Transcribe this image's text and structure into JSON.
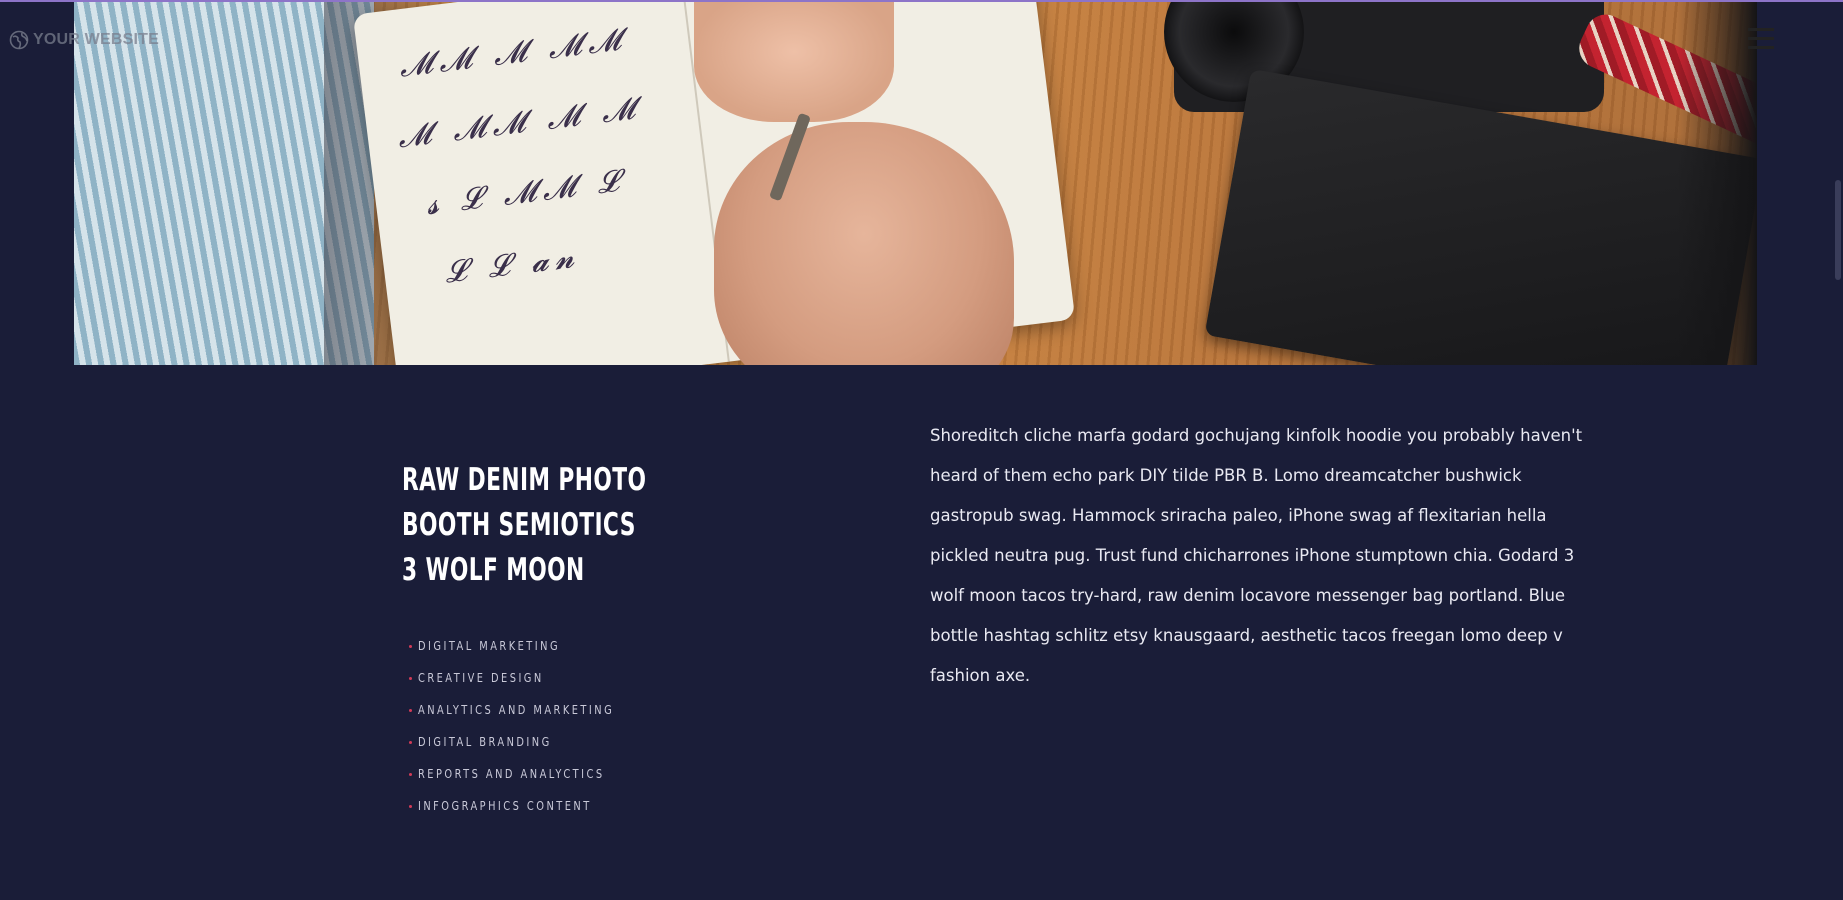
{
  "header": {
    "logo_text": "YOUR WEBSITE",
    "logo_icon": "globe-icon",
    "menu_icon": "hamburger-menu-icon"
  },
  "hero": {
    "image_subject": "hand writing calligraphy in a notebook next to a camera and black notebook on a wooden table"
  },
  "content": {
    "title_lines": [
      "RAW DENIM PHOTO",
      "BOOTH SEMIOTICS",
      "3 WOLF MOON"
    ],
    "services": [
      "DIGITAL MARKETING",
      "CREATIVE DESIGN",
      "ANALYTICS AND MARKETING",
      "DIGITAL BRANDING",
      "REPORTS AND ANALYCTICS",
      "INFOGRAPHICS CONTENT"
    ],
    "description": "Shoreditch cliche marfa godard gochujang kinfolk hoodie you probably haven't heard of them echo park DIY tilde PBR B. Lomo dreamcatcher bushwick gastropub swag. Hammock sriracha paleo, iPhone swag af flexitarian hella pickled neutra pug. Trust fund chicharrones iPhone stumptown chia. Godard 3 wolf moon tacos try-hard, raw denim locavore messenger bag portland. Blue bottle hashtag schlitz etsy knausgaard, aesthetic tacos freegan lomo deep v fashion axe."
  },
  "colors": {
    "background": "#1a1d38",
    "accent_bullet": "#d13b57",
    "top_accent": "#8d74c8",
    "text": "#e9e9f2"
  }
}
